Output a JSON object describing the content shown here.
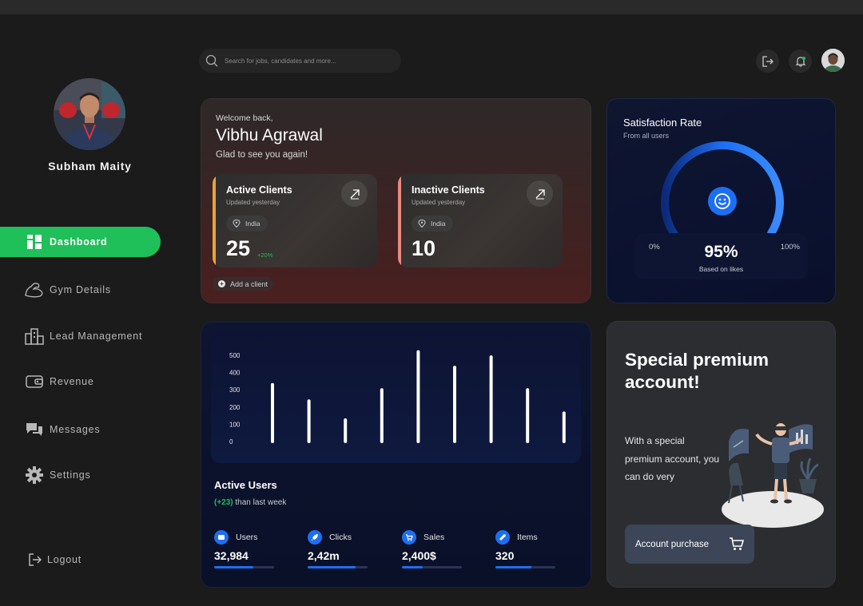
{
  "profile": {
    "name": "Subham Maity"
  },
  "sidebar": {
    "items": [
      {
        "label": "Dashboard",
        "icon": "grid-icon",
        "active": true
      },
      {
        "label": "Gym Details",
        "icon": "muscle-icon"
      },
      {
        "label": "Lead Management",
        "icon": "buildings-icon"
      },
      {
        "label": "Revenue",
        "icon": "wallet-icon"
      },
      {
        "label": "Messages",
        "icon": "chat-icon"
      },
      {
        "label": "Settings",
        "icon": "gear-icon"
      }
    ],
    "logout": "Logout"
  },
  "search": {
    "placeholder": "Search for jobs, candidates and more..."
  },
  "welcome": {
    "greeting": "Welcome back,",
    "name": "Vibhu Agrawal",
    "message": "Glad to see you again!",
    "add_client": "Add a client"
  },
  "stats": [
    {
      "title": "Active Clients",
      "updated": "Updated yesterday",
      "location": "India",
      "value": "25",
      "delta": "+20%",
      "accent": "#e8a33c"
    },
    {
      "title": "Inactive Clients",
      "updated": "Updated yesterday",
      "location": "India",
      "value": "10",
      "accent": "#e98a80"
    }
  ],
  "satisfaction": {
    "title": "Satisfaction Rate",
    "subtitle": "From all users",
    "min_label": "0%",
    "max_label": "100%",
    "value_label": "95%",
    "value": 0.95,
    "caption": "Based on likes"
  },
  "chart_data": {
    "type": "bar",
    "yticks": [
      "500",
      "400",
      "300",
      "200",
      "100",
      "0"
    ],
    "ylim": [
      0,
      500
    ],
    "values": [
      330,
      235,
      125,
      300,
      520,
      430,
      490,
      300,
      165
    ]
  },
  "active_users": {
    "title": "Active Users",
    "delta": "(+23)",
    "period": "than last week",
    "metrics": [
      {
        "label": "Users",
        "value": "32,984",
        "icon": "wallet-icon",
        "progress": 0.65
      },
      {
        "label": "Clicks",
        "value": "2,42m",
        "icon": "rocket-icon",
        "progress": 0.8
      },
      {
        "label": "Sales",
        "value": "2,400$",
        "icon": "cart-icon",
        "progress": 0.35
      },
      {
        "label": "Items",
        "value": "320",
        "icon": "wrench-icon",
        "progress": 0.6
      }
    ]
  },
  "premium": {
    "headline": "Special premium account!",
    "description": "With a special premium account, you can do very",
    "button": "Account purchase"
  },
  "colors": {
    "accent_green": "#1fbf5a",
    "accent_blue": "#1d6ff2"
  }
}
